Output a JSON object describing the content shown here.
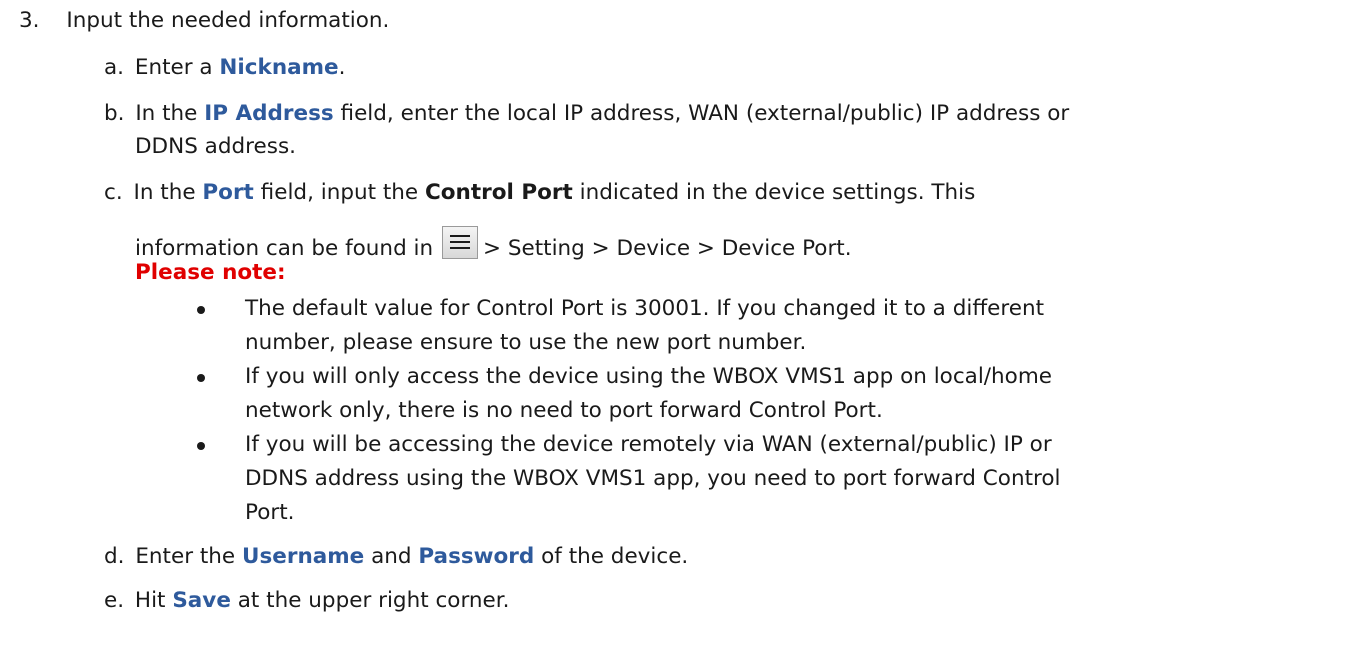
{
  "step3": {
    "number": "3.",
    "text": "Input the needed information."
  },
  "a": {
    "marker": "a.",
    "pre": "Enter a ",
    "term": "Nickname",
    "post": "."
  },
  "b": {
    "marker": "b.",
    "pre": "In the ",
    "term": "IP Address",
    "post": " field, enter the local IP address, WAN (external/public) IP address or",
    "line2": "DDNS address."
  },
  "c": {
    "marker": "c.",
    "pre": "In the ",
    "term": "Port",
    "mid": " field, input the ",
    "term2": "Control Port",
    "post": " indicated in the device settings. This",
    "line2_pre": "information can be found in",
    "line2_post": "> Setting > Device > Device Port.",
    "icon": "menu-icon"
  },
  "note": {
    "heading": "Please note:",
    "bullets": [
      {
        "line1": "The default value for Control Port is 30001. If you changed it to a different",
        "line2": "number, please ensure to use the new port number."
      },
      {
        "line1": "If you will only access the device using the WBOX VMS1 app on local/home",
        "line2": "network only, there is no need to port forward Control Port."
      },
      {
        "line1": "If you will be accessing the device remotely via WAN (external/public) IP or",
        "line2": "DDNS address using the WBOX VMS1 app, you need to port forward Control",
        "line3": "Port."
      }
    ]
  },
  "d": {
    "marker": "d.",
    "pre": "Enter the ",
    "term": "Username",
    "mid": " and ",
    "term2": "Password",
    "post": " of the device."
  },
  "e": {
    "marker": "e.",
    "pre": "Hit ",
    "term": "Save",
    "post": " at the upper right corner."
  },
  "colors": {
    "term_blue": "#2e5a9c",
    "note_red": "#e00000",
    "text": "#1a1a1a"
  }
}
